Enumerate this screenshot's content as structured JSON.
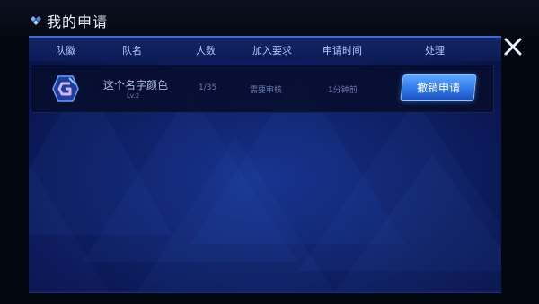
{
  "window": {
    "title": "我的申请"
  },
  "table": {
    "headers": [
      "队徽",
      "队名",
      "人数",
      "加入要求",
      "申请时间",
      "处理"
    ]
  },
  "request": {
    "team_name": "这个名字颜色",
    "team_level": "Lv.2",
    "members": "1/35",
    "requirement": "需要审核",
    "time": "1分钟前",
    "action_label": "撤销申请"
  },
  "colors": {
    "accent": "#2f78ea",
    "panel": "#0f2168",
    "header_text": "#b9cbff"
  },
  "icons": {
    "title": "diamond-cluster-icon",
    "close": "close-icon",
    "team": "team-emblem-icon"
  }
}
